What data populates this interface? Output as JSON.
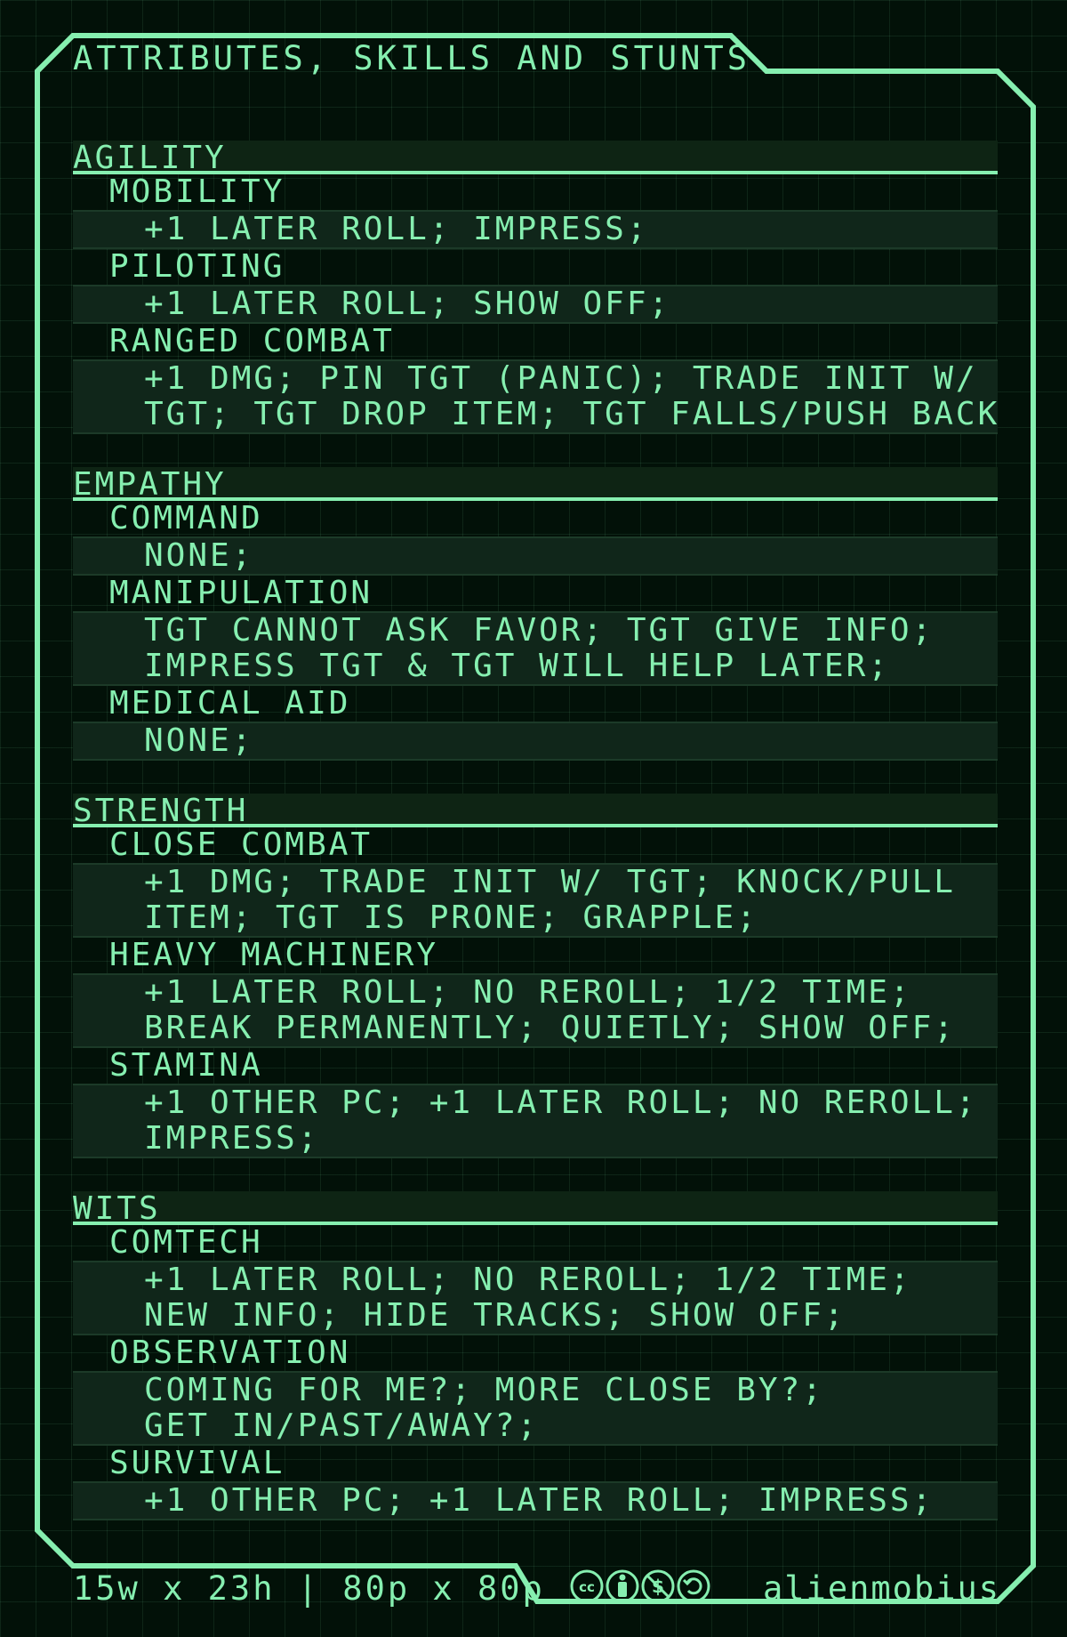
{
  "title": "ATTRIBUTES, SKILLS AND STUNTS",
  "attributes": [
    {
      "name": "AGILITY",
      "skills": [
        {
          "name": "MOBILITY",
          "stunts": [
            "+1 LATER ROLL; IMPRESS;"
          ]
        },
        {
          "name": "PILOTING",
          "stunts": [
            "+1 LATER ROLL; SHOW OFF;"
          ]
        },
        {
          "name": "RANGED COMBAT",
          "stunts": [
            "+1 DMG; PIN TGT (PANIC); TRADE INIT W/",
            "TGT; TGT DROP ITEM; TGT FALLS/PUSH BACK;"
          ]
        }
      ]
    },
    {
      "name": "EMPATHY",
      "skills": [
        {
          "name": "COMMAND",
          "stunts": [
            "NONE;"
          ]
        },
        {
          "name": "MANIPULATION",
          "stunts": [
            "TGT CANNOT ASK FAVOR; TGT GIVE INFO;",
            "IMPRESS TGT & TGT WILL HELP LATER;"
          ]
        },
        {
          "name": "MEDICAL AID",
          "stunts": [
            "NONE;"
          ]
        }
      ]
    },
    {
      "name": "STRENGTH",
      "skills": [
        {
          "name": "CLOSE COMBAT",
          "stunts": [
            "+1 DMG; TRADE INIT W/ TGT; KNOCK/PULL",
            "ITEM; TGT IS PRONE; GRAPPLE;"
          ]
        },
        {
          "name": "HEAVY MACHINERY",
          "stunts": [
            "+1 LATER ROLL; NO REROLL; 1/2 TIME;",
            "BREAK PERMANENTLY; QUIETLY; SHOW OFF;"
          ]
        },
        {
          "name": "STAMINA",
          "stunts": [
            "+1 OTHER PC; +1 LATER ROLL; NO REROLL;",
            "IMPRESS;"
          ]
        }
      ]
    },
    {
      "name": "WITS",
      "skills": [
        {
          "name": "COMTECH",
          "stunts": [
            "+1 LATER ROLL; NO REROLL; 1/2 TIME;",
            "NEW INFO; HIDE TRACKS; SHOW OFF;"
          ]
        },
        {
          "name": "OBSERVATION",
          "stunts": [
            "COMING FOR ME?; MORE CLOSE BY?;",
            "GET IN/PAST/AWAY?;"
          ]
        },
        {
          "name": "SURVIVAL",
          "stunts": [
            "+1 OTHER PC; +1 LATER ROLL; IMPRESS;"
          ]
        }
      ]
    }
  ],
  "footer": {
    "dimensions": "15w x 23h | 80p x 80p",
    "license_icons": [
      "cc-icon",
      "by-icon",
      "nc-icon",
      "sa-icon"
    ],
    "author": "alienmobius"
  },
  "colors": {
    "background": "#021108",
    "accent": "#86efb0",
    "row_fill": "#10261a"
  }
}
